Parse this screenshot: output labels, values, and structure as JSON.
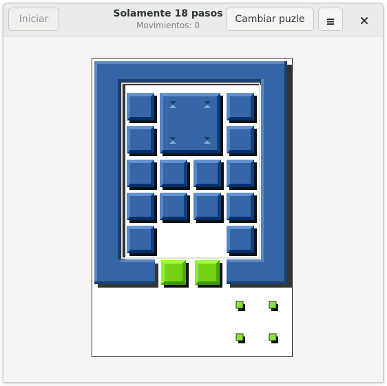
{
  "header": {
    "start_label": "Iniciar",
    "title": "Solamente 18 pasos",
    "subtitle": "Movimientos: 0",
    "change_label": "Cambiar puzle",
    "menu_icon": "hamburger-menu-icon",
    "close_icon": "close-icon"
  },
  "colors": {
    "frame": "#3465a4",
    "frame_dark": "#1b3f6e",
    "frame_light": "#5c86c0",
    "block": "#3566a6",
    "goal_block": "#73d216",
    "background": "#f6f5f4"
  },
  "puzzle": {
    "blocks_count": 15,
    "target_marks": 4
  }
}
